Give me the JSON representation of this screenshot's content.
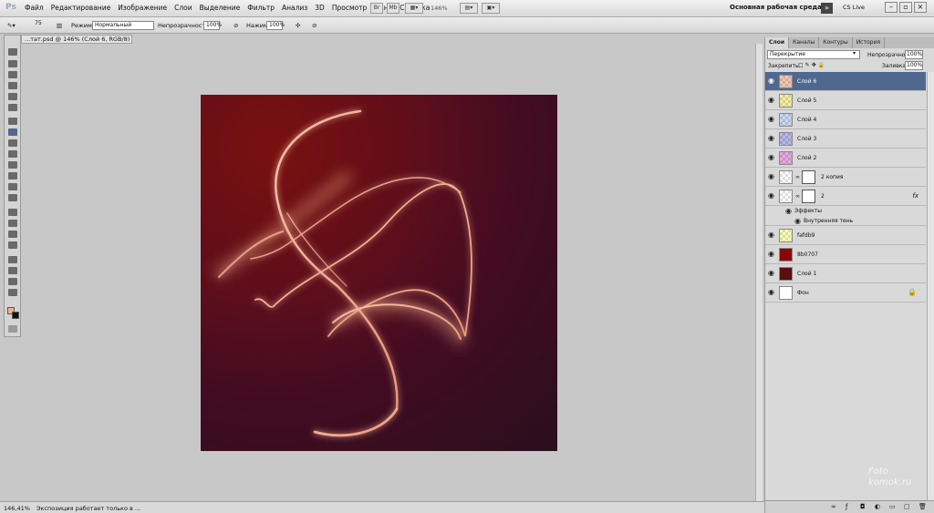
{
  "app": {
    "logo": "Ps"
  },
  "menu": [
    "Файл",
    "Редактирование",
    "Изображение",
    "Слои",
    "Выделение",
    "Фильтр",
    "Анализ",
    "3D",
    "Просмотр",
    "Окно",
    "Справка"
  ],
  "toolbar_top": {
    "br_label": "Br",
    "mb_label": "Mb",
    "zoom": "146%"
  },
  "workspace": {
    "label": "Основная рабочая среда",
    "cslive": "CS Live"
  },
  "options": {
    "brush_size": "75",
    "mode_label": "Режим:",
    "mode_value": "Нормальный",
    "opacity_label": "Непрозрачность:",
    "opacity_value": "100%",
    "pressure_label": "Нажим:",
    "pressure_value": "100%"
  },
  "document": {
    "tab_title": "...тат.psd @ 146% (Слой 6, RGB/8) *"
  },
  "status": {
    "zoom": "146,41%",
    "info": "Экспозиция работает только в ..."
  },
  "panel": {
    "tabs": [
      "Слои",
      "Каналы",
      "Контуры",
      "История"
    ],
    "blend_mode": "Перекрытие",
    "opacity_label": "Непрозрачность:",
    "opacity_value": "100%",
    "lock_label": "Закрепить:",
    "fill_label": "Заливка:",
    "fill_value": "100%"
  },
  "layers": [
    {
      "name": "Слой 6",
      "selected": true,
      "thumb": "#f2c6b0"
    },
    {
      "name": "Слой 5",
      "thumb": "#f5f0a0"
    },
    {
      "name": "Слой 4",
      "thumb": "#c8d8f0"
    },
    {
      "name": "Слой 3",
      "thumb": "#b8b8e8"
    },
    {
      "name": "Слой 2",
      "thumb": "#e8a8e0"
    },
    {
      "name": "2 копия",
      "mask": true
    },
    {
      "name": "2",
      "mask": true,
      "fx": "fx"
    },
    {
      "name": "Эффекты",
      "sub": true
    },
    {
      "name": "Внутренняя тень",
      "sub": true
    },
    {
      "name": "fafdb9",
      "thumb": "#fafdb9"
    },
    {
      "name": "8b0707",
      "thumb": "#8b0707",
      "solid": true
    },
    {
      "name": "Слой 1",
      "thumb": "#5a0e10",
      "solid": true
    },
    {
      "name": "Фон",
      "thumb": "#ffffff",
      "solid": true,
      "locked": true
    }
  ],
  "watermark": {
    "line1": "Foto",
    "line2": "komok.ru"
  },
  "colors": {
    "selected_layer": "#4f6890",
    "canvas_dark": "#1c0f18",
    "canvas_red": "#7a1008",
    "foreground": "#f3b08a"
  }
}
